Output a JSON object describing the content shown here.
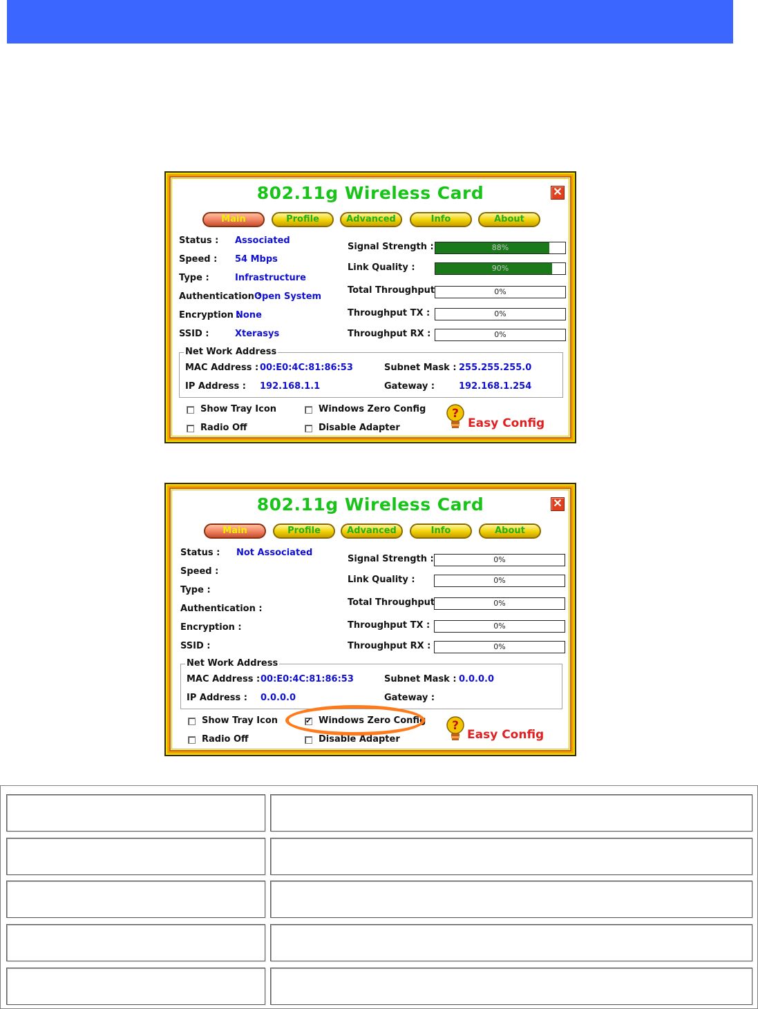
{
  "header": {
    "color": "#3b66ff"
  },
  "windows": [
    {
      "title": "802.11g Wireless Card",
      "close_icon": "close-icon",
      "tabs": [
        "Main",
        "Profile",
        "Advanced",
        "Info",
        "About"
      ],
      "active_tab": "Main",
      "labels": {
        "status": "Status :",
        "speed": "Speed :",
        "type": "Type :",
        "authentication": "Authentication :",
        "encryption": "Encryption :",
        "ssid": "SSID :",
        "signal_strength": "Signal Strength :",
        "link_quality": "Link Quality :",
        "total_throughput": "Total Throughput :",
        "throughput_tx": "Throughput TX :",
        "throughput_rx": "Throughput RX :"
      },
      "values": {
        "status": "Associated",
        "speed": "54 Mbps",
        "type": "Infrastructure",
        "authentication": "Open System",
        "encryption": "None",
        "ssid": "Xterasys"
      },
      "meters": {
        "signal_strength": {
          "text": "88%",
          "level": 0.88
        },
        "link_quality": {
          "text": "90%",
          "level": 0.9
        },
        "total_throughput": {
          "text": "0%",
          "level": 0
        },
        "throughput_tx": {
          "text": "0%",
          "level": 0
        },
        "throughput_rx": {
          "text": "0%",
          "level": 0
        }
      },
      "network": {
        "title": "Net Work Address",
        "mac_label": "MAC Address :",
        "mac_value": "00:E0:4C:81:86:53",
        "ip_label": "IP Address :",
        "ip_value": "192.168.1.1",
        "subnet_label": "Subnet Mask :",
        "subnet_value": "255.255.255.0",
        "gateway_label": "Gateway :",
        "gateway_value": "192.168.1.254"
      },
      "options": {
        "show_tray_icon": {
          "label": "Show Tray Icon",
          "checked": false
        },
        "radio_off": {
          "label": "Radio Off",
          "checked": false
        },
        "windows_zero_config": {
          "label": "Windows Zero Config",
          "checked": false
        },
        "disable_adapter": {
          "label": "Disable Adapter",
          "checked": false
        }
      },
      "easy_config": "Easy Config"
    },
    {
      "title": "802.11g Wireless Card",
      "close_icon": "close-icon",
      "tabs": [
        "Main",
        "Profile",
        "Advanced",
        "Info",
        "About"
      ],
      "active_tab": "Main",
      "labels": {
        "status": "Status :",
        "speed": "Speed :",
        "type": "Type :",
        "authentication": "Authentication :",
        "encryption": "Encryption :",
        "ssid": "SSID :",
        "signal_strength": "Signal Strength :",
        "link_quality": "Link Quality :",
        "total_throughput": "Total Throughput :",
        "throughput_tx": "Throughput TX :",
        "throughput_rx": "Throughput RX :"
      },
      "values": {
        "status": "Not Associated",
        "speed": "",
        "type": "",
        "authentication": "",
        "encryption": "",
        "ssid": ""
      },
      "meters": {
        "signal_strength": {
          "text": "0%",
          "level": 0
        },
        "link_quality": {
          "text": "0%",
          "level": 0
        },
        "total_throughput": {
          "text": "0%",
          "level": 0
        },
        "throughput_tx": {
          "text": "0%",
          "level": 0
        },
        "throughput_rx": {
          "text": "0%",
          "level": 0
        }
      },
      "network": {
        "title": "Net Work Address",
        "mac_label": "MAC Address :",
        "mac_value": "00:E0:4C:81:86:53",
        "ip_label": "IP Address :",
        "ip_value": "0.0.0.0",
        "subnet_label": "Subnet Mask :",
        "subnet_value": "0.0.0.0",
        "gateway_label": "Gateway :",
        "gateway_value": ""
      },
      "options": {
        "show_tray_icon": {
          "label": "Show Tray Icon",
          "checked": false
        },
        "radio_off": {
          "label": "Radio Off",
          "checked": false
        },
        "windows_zero_config": {
          "label": "Windows Zero Config",
          "checked": true
        },
        "disable_adapter": {
          "label": "Disable Adapter",
          "checked": false
        }
      },
      "easy_config": "Easy Config",
      "highlight": "windows_zero_config"
    }
  ],
  "doc_table": {
    "rows": 5,
    "cols": 2
  }
}
